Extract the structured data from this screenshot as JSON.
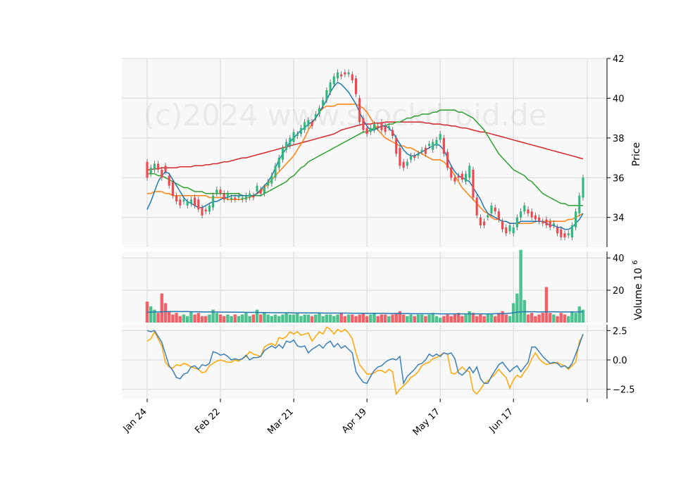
{
  "chart_data": {
    "type": "candlestick",
    "watermark": "(c)2024 www.stockdroid.de",
    "x_tick_labels": [
      "Jan 24",
      "Feb 22",
      "Mar 21",
      "Apr 19",
      "May 17",
      "Jun 17"
    ],
    "x_tick_indices": [
      0,
      20,
      40,
      60,
      80,
      100
    ],
    "colors": {
      "up": "#2db87c",
      "down": "#f0474e",
      "ma_short": "#1f77b4",
      "ma_mid": "#ff7f0e",
      "ma_long": "#2ca02c",
      "ma_200": "#d62728",
      "osc_1": "#3b7fb8",
      "osc_2": "#ffa500",
      "volume_ma": "#1f77b4",
      "panel_bg": "#f8f8f8",
      "grid": "#d8d8d8"
    },
    "price_panel": {
      "ylabel": "Price",
      "ylim": [
        32.5,
        42
      ],
      "yticks": [
        34,
        36,
        38,
        40,
        42
      ],
      "open": [
        36.8,
        36.2,
        36.4,
        36.7,
        36.4,
        36.6,
        36.1,
        35.8,
        35.1,
        34.9,
        34.8,
        34.6,
        34.7,
        35.0,
        34.9,
        34.5,
        34.4,
        34.3,
        34.5,
        35.2,
        35.4,
        35.2,
        35.0,
        34.9,
        35.0,
        35.0,
        34.9,
        34.9,
        35.0,
        35.1,
        35.3,
        35.4,
        35.2,
        35.6,
        35.7,
        36.0,
        36.5,
        36.9,
        37.4,
        37.6,
        37.8,
        38.1,
        38.2,
        38.4,
        38.6,
        38.8,
        39.0,
        39.2,
        39.6,
        39.9,
        40.3,
        40.7,
        41.0,
        41.2,
        41.3,
        41.2,
        41.2,
        41.0,
        40.0,
        39.0,
        38.5,
        38.3,
        38.4,
        38.6,
        38.8,
        38.6,
        38.5,
        38.4,
        38.0,
        37.5,
        36.8,
        36.6,
        36.9,
        37.1,
        37.1,
        37.3,
        37.5,
        37.6,
        37.4,
        37.6,
        37.9,
        38.0,
        37.3,
        36.5,
        36.0,
        36.1,
        36.2,
        35.8,
        36.0,
        36.4,
        35.0,
        34.0,
        33.8,
        34.0,
        34.2,
        34.5,
        34.3,
        33.8,
        33.5,
        33.3,
        33.2,
        33.5,
        34.0,
        34.3,
        34.4,
        34.3,
        34.1,
        34.0,
        33.8,
        33.9,
        33.8,
        33.6,
        33.5,
        33.4,
        33.2,
        33.1,
        33.0,
        33.5,
        34.2,
        35.0
      ],
      "close": [
        36.0,
        36.5,
        36.7,
        36.4,
        36.0,
        36.3,
        35.6,
        35.1,
        34.8,
        34.6,
        34.9,
        34.8,
        34.9,
        34.6,
        34.4,
        34.1,
        34.3,
        34.6,
        35.1,
        35.4,
        35.2,
        34.9,
        35.2,
        35.0,
        34.9,
        35.1,
        35.0,
        35.1,
        35.2,
        35.0,
        35.6,
        35.2,
        35.5,
        35.8,
        36.1,
        36.6,
        37.0,
        37.5,
        37.8,
        38.0,
        38.3,
        38.2,
        38.5,
        38.8,
        38.9,
        38.6,
        39.2,
        39.5,
        39.9,
        40.4,
        40.8,
        41.1,
        41.3,
        41.1,
        41.2,
        41.3,
        40.9,
        40.2,
        38.8,
        38.4,
        38.2,
        38.5,
        38.7,
        38.5,
        38.4,
        38.3,
        38.6,
        38.1,
        37.2,
        36.6,
        36.5,
        36.8,
        37.1,
        37.0,
        37.2,
        37.4,
        37.2,
        37.7,
        37.8,
        37.9,
        38.2,
        37.2,
        36.5,
        36.0,
        35.8,
        36.0,
        35.9,
        36.2,
        36.6,
        35.0,
        34.1,
        33.6,
        33.6,
        34.1,
        34.6,
        34.3,
        33.9,
        33.4,
        33.2,
        33.6,
        33.5,
        34.0,
        34.3,
        34.6,
        34.2,
        34.0,
        33.9,
        33.8,
        33.7,
        33.6,
        33.5,
        33.7,
        33.2,
        33.0,
        33.0,
        33.2,
        33.6,
        34.3,
        35.1,
        36.0
      ],
      "ma_short": [
        34.4,
        34.8,
        35.3,
        35.8,
        36.1,
        36.3,
        36.2,
        35.9,
        35.6,
        35.3,
        35.0,
        34.8,
        34.7,
        34.6,
        34.5,
        34.5,
        34.6,
        34.7,
        34.8,
        34.8,
        34.9,
        35.0,
        35.0,
        35.1,
        35.1,
        35.1,
        35.1,
        35.1,
        35.1,
        35.1,
        35.2,
        35.4,
        35.6,
        35.8,
        36.1,
        36.5,
        36.9,
        37.2,
        37.5,
        37.8,
        38.0,
        38.2,
        38.4,
        38.5,
        38.7,
        38.8,
        39.0,
        39.3,
        39.6,
        39.9,
        40.3,
        40.6,
        40.8,
        40.7,
        40.5,
        40.3,
        40.0,
        39.7,
        39.3,
        38.9,
        38.6,
        38.4,
        38.4,
        38.5,
        38.6,
        38.6,
        38.5,
        38.3,
        38.0,
        37.7,
        37.4,
        37.2,
        37.1,
        37.1,
        37.2,
        37.3,
        37.4,
        37.5,
        37.6,
        37.7,
        37.6,
        37.4,
        37.0,
        36.6,
        36.3,
        36.1,
        36.0,
        35.9,
        35.8,
        35.5,
        35.2,
        34.9,
        34.5,
        34.2,
        34.1,
        34.0,
        33.9,
        33.8,
        33.8,
        33.7,
        33.7,
        33.7,
        33.8,
        33.8,
        33.8,
        33.8,
        33.8,
        33.8,
        33.8,
        33.7,
        33.6,
        33.6,
        33.5,
        33.5,
        33.4,
        33.4,
        33.5,
        33.7,
        33.9,
        34.2
      ],
      "ma_mid": [
        35.2,
        35.2,
        35.3,
        35.3,
        35.3,
        35.2,
        35.2,
        35.1,
        35.1,
        35.1,
        35.1,
        35.1,
        35.1,
        35.1,
        35.1,
        35.1,
        35.1,
        35.0,
        35.0,
        35.0,
        35.0,
        35.0,
        34.9,
        34.9,
        34.9,
        34.9,
        34.9,
        35.0,
        35.0,
        35.1,
        35.2,
        35.3,
        35.5,
        35.7,
        35.9,
        36.1,
        36.3,
        36.5,
        36.7,
        36.9,
        37.1,
        37.4,
        37.7,
        38.0,
        38.4,
        38.7,
        39.0,
        39.3,
        39.5,
        39.6,
        39.6,
        39.6,
        39.7,
        39.7,
        39.7,
        39.7,
        39.7,
        39.7,
        39.6,
        39.5,
        39.3,
        39.0,
        38.7,
        38.4,
        38.2,
        38.0,
        37.9,
        37.8,
        37.7,
        37.6,
        37.6,
        37.5,
        37.5,
        37.4,
        37.3,
        37.2,
        37.1,
        37.0,
        36.9,
        36.9,
        36.9,
        36.8,
        36.6,
        36.4,
        36.1,
        35.8,
        35.5,
        35.3,
        35.1,
        34.9,
        34.7,
        34.5,
        34.3,
        34.2,
        34.0,
        33.9,
        33.9,
        33.8,
        33.8,
        33.7,
        33.7,
        33.7,
        33.7,
        33.7,
        33.7,
        33.7,
        33.8,
        33.8,
        33.8,
        33.8,
        33.8,
        33.8,
        33.8,
        33.8,
        33.8,
        33.9,
        33.9,
        34.0,
        34.1,
        34.2
      ],
      "ma_long": [
        36.2,
        36.2,
        36.2,
        36.1,
        36.1,
        36.0,
        35.9,
        35.8,
        35.7,
        35.6,
        35.5,
        35.5,
        35.4,
        35.3,
        35.3,
        35.3,
        35.2,
        35.2,
        35.2,
        35.2,
        35.2,
        35.2,
        35.2,
        35.2,
        35.2,
        35.2,
        35.1,
        35.1,
        35.1,
        35.1,
        35.1,
        35.1,
        35.2,
        35.3,
        35.4,
        35.5,
        35.6,
        35.7,
        35.8,
        36.0,
        36.1,
        36.3,
        36.5,
        36.6,
        36.8,
        36.9,
        37.0,
        37.1,
        37.2,
        37.3,
        37.4,
        37.5,
        37.6,
        37.7,
        37.8,
        37.9,
        38.0,
        38.1,
        38.2,
        38.3,
        38.3,
        38.4,
        38.5,
        38.5,
        38.6,
        38.6,
        38.7,
        38.7,
        38.8,
        38.8,
        38.9,
        39.0,
        39.0,
        39.1,
        39.1,
        39.2,
        39.2,
        39.2,
        39.3,
        39.3,
        39.4,
        39.4,
        39.4,
        39.4,
        39.4,
        39.3,
        39.3,
        39.2,
        39.1,
        39.0,
        38.8,
        38.6,
        38.4,
        38.1,
        37.8,
        37.5,
        37.2,
        37.0,
        36.8,
        36.6,
        36.4,
        36.3,
        36.2,
        36.1,
        35.9,
        35.8,
        35.6,
        35.4,
        35.2,
        35.1,
        35.0,
        34.9,
        34.8,
        34.7,
        34.7,
        34.6,
        34.6,
        34.6,
        34.6,
        34.6
      ],
      "ma_200": [
        36.4,
        36.4,
        36.45,
        36.45,
        36.5,
        36.5,
        36.5,
        36.5,
        36.5,
        36.55,
        36.55,
        36.55,
        36.55,
        36.6,
        36.6,
        36.6,
        36.65,
        36.65,
        36.7,
        36.7,
        36.75,
        36.8,
        36.8,
        36.85,
        36.9,
        36.95,
        37.0,
        37.0,
        37.05,
        37.1,
        37.15,
        37.2,
        37.25,
        37.3,
        37.35,
        37.4,
        37.45,
        37.5,
        37.55,
        37.6,
        37.65,
        37.7,
        37.75,
        37.8,
        37.85,
        37.9,
        37.95,
        38.0,
        38.05,
        38.1,
        38.15,
        38.2,
        38.3,
        38.4,
        38.45,
        38.5,
        38.55,
        38.6,
        38.65,
        38.7,
        38.7,
        38.7,
        38.75,
        38.75,
        38.75,
        38.8,
        38.8,
        38.8,
        38.8,
        38.8,
        38.8,
        38.8,
        38.8,
        38.8,
        38.8,
        38.8,
        38.75,
        38.75,
        38.7,
        38.7,
        38.7,
        38.65,
        38.65,
        38.6,
        38.6,
        38.55,
        38.5,
        38.5,
        38.45,
        38.4,
        38.35,
        38.3,
        38.3,
        38.25,
        38.2,
        38.15,
        38.1,
        38.05,
        38.0,
        37.95,
        37.9,
        37.85,
        37.8,
        37.75,
        37.7,
        37.65,
        37.6,
        37.55,
        37.5,
        37.45,
        37.4,
        37.35,
        37.3,
        37.25,
        37.2,
        37.15,
        37.1,
        37.05,
        37.0,
        36.95
      ]
    },
    "volume_panel": {
      "ylabel": "Volume",
      "ylabel_exponent": "6",
      "ylim": [
        0,
        44
      ],
      "yticks": [
        20,
        40
      ],
      "values": [
        13,
        10,
        8,
        6,
        18,
        12,
        7,
        5,
        6,
        4,
        5,
        4,
        7,
        5,
        6,
        4,
        4,
        5,
        8,
        6,
        5,
        4,
        5,
        4,
        5,
        4,
        5,
        6,
        4,
        5,
        8,
        5,
        6,
        5,
        4,
        5,
        4,
        5,
        6,
        5,
        5,
        6,
        4,
        5,
        5,
        4,
        5,
        6,
        4,
        5,
        5,
        4,
        5,
        6,
        4,
        5,
        5,
        4,
        5,
        6,
        4,
        5,
        6,
        4,
        5,
        5,
        4,
        5,
        6,
        7,
        5,
        4,
        5,
        4,
        5,
        5,
        4,
        5,
        6,
        4,
        3,
        4,
        5,
        4,
        5,
        6,
        4,
        5,
        7,
        6,
        4,
        5,
        4,
        5,
        5,
        4,
        6,
        7,
        5,
        4,
        12,
        18,
        45,
        14,
        5,
        6,
        4,
        5,
        6,
        22,
        6,
        5,
        4,
        6,
        5,
        4,
        7,
        6,
        10,
        8
      ],
      "ma": [
        6.4,
        6.5,
        6.6,
        6.6,
        6.7,
        6.8,
        6.8,
        6.8,
        6.8,
        6.8,
        6.8,
        6.8,
        6.7,
        6.7,
        6.7,
        6.6,
        6.6,
        6.6,
        6.6,
        6.6,
        6.5,
        6.5,
        6.5,
        6.5,
        6.4,
        6.4,
        6.4,
        6.3,
        6.3,
        6.3,
        6.3,
        6.2,
        6.2,
        6.2,
        6.1,
        6.1,
        6.1,
        6.1,
        6.1,
        6.1,
        6.0,
        6.0,
        6.0,
        6.0,
        6.0,
        6.0,
        6.0,
        6.0,
        5.9,
        5.9,
        5.9,
        5.9,
        5.9,
        5.9,
        5.9,
        5.9,
        5.8,
        5.8,
        5.8,
        5.8,
        5.7,
        5.7,
        5.7,
        5.7,
        5.7,
        5.7,
        5.6,
        5.6,
        5.6,
        5.6,
        5.6,
        5.6,
        5.5,
        5.5,
        5.5,
        5.5,
        5.5,
        5.5,
        5.5,
        5.5,
        5.4,
        5.4,
        5.4,
        5.4,
        5.4,
        5.4,
        5.4,
        5.4,
        5.4,
        5.4,
        5.4,
        5.4,
        5.4,
        5.4,
        5.4,
        5.5,
        5.5,
        5.5,
        5.6,
        5.8,
        6.1,
        6.5,
        6.6,
        6.7,
        6.7,
        6.7,
        6.7,
        6.6,
        6.6,
        6.7,
        6.7,
        6.7,
        6.6,
        6.6,
        6.6,
        6.6,
        6.6,
        6.6,
        6.7,
        6.7
      ]
    },
    "oscillator_panel": {
      "ylim": [
        -3.3,
        3.0
      ],
      "yticks": [
        2.5,
        0.0,
        -2.5
      ],
      "ytick_labels": [
        "2.5",
        "0.0",
        "−2.5"
      ],
      "line_1": [
        2.5,
        2.4,
        2.5,
        2.0,
        1.5,
        0.5,
        -0.5,
        -0.9,
        -1.5,
        -1.6,
        -1.2,
        -1.1,
        -0.6,
        -0.5,
        -0.8,
        -0.4,
        -0.5,
        -0.3,
        0.7,
        0.6,
        0.4,
        0.5,
        0.3,
        0.0,
        0.1,
        0.0,
        0.1,
        0.4,
        0.0,
        0.2,
        0.2,
        0.3,
        0.8,
        1.0,
        1.2,
        1.0,
        1.3,
        1.0,
        1.6,
        1.5,
        1.7,
        1.2,
        1.1,
        1.2,
        0.6,
        0.9,
        1.1,
        1.3,
        1.0,
        1.4,
        1.6,
        1.1,
        1.4,
        1.0,
        1.2,
        0.9,
        0.6,
        -1.0,
        -1.5,
        -1.9,
        -2.0,
        -1.4,
        -0.9,
        -0.6,
        -0.5,
        -0.2,
        0.0,
        0.1,
        0.0,
        0.3,
        -2.0,
        -1.4,
        -1.1,
        -0.8,
        -0.4,
        -0.3,
        0.0,
        0.5,
        0.3,
        0.5,
        0.3,
        0.6,
        0.5,
        0.6,
        0.1,
        -1.1,
        -1.3,
        -1.0,
        -0.6,
        -1.1,
        -0.6,
        -1.6,
        -2.0,
        -2.0,
        -1.4,
        -0.9,
        -0.4,
        -0.2,
        -0.6,
        -1.0,
        -0.7,
        -0.5,
        -1.0,
        -0.6,
        -0.2,
        1.1,
        1.1,
        0.7,
        0.3,
        0.0,
        -0.3,
        -0.2,
        -0.3,
        -0.6,
        -0.5,
        -0.7,
        -0.3,
        0.5,
        1.3,
        2.2
      ],
      "line_2": [
        1.6,
        1.8,
        2.4,
        1.8,
        1.2,
        -0.2,
        -0.6,
        -0.7,
        -0.4,
        -0.5,
        -0.3,
        -0.4,
        -0.6,
        -0.7,
        -0.8,
        -1.1,
        -1.0,
        -0.5,
        -0.3,
        -0.1,
        0.0,
        -0.1,
        -0.2,
        -0.2,
        0.0,
        -0.1,
        0.1,
        0.3,
        0.7,
        0.5,
        0.4,
        0.3,
        1.1,
        1.3,
        1.4,
        1.2,
        1.9,
        1.8,
        2.0,
        2.4,
        2.2,
        2.4,
        2.1,
        2.2,
        2.3,
        1.6,
        2.0,
        2.4,
        2.2,
        2.8,
        2.6,
        2.2,
        2.6,
        2.4,
        2.6,
        2.3,
        1.8,
        0.6,
        -0.4,
        -0.8,
        -1.2,
        -1.2,
        -1.1,
        -0.9,
        -0.9,
        -1.1,
        -0.8,
        -1.0,
        -2.9,
        -2.5,
        -2.2,
        -1.9,
        -1.5,
        -1.3,
        -1.0,
        -0.5,
        -0.3,
        -0.2,
        0.1,
        0.2,
        0.4,
        0.6,
        0.5,
        -1.1,
        -1.2,
        -0.9,
        -0.6,
        -0.9,
        -1.0,
        -2.6,
        -2.9,
        -2.5,
        -2.0,
        -1.8,
        -1.5,
        -1.2,
        -0.8,
        -1.2,
        -1.5,
        -2.4,
        -1.7,
        -1.3,
        -1.5,
        -1.0,
        -0.6,
        0.1,
        0.6,
        0.1,
        -0.2,
        -0.4,
        -0.3,
        -0.3,
        -0.2,
        -0.4,
        -0.5,
        -0.8,
        -0.5,
        -0.2,
        1.6,
        2.1
      ]
    }
  }
}
